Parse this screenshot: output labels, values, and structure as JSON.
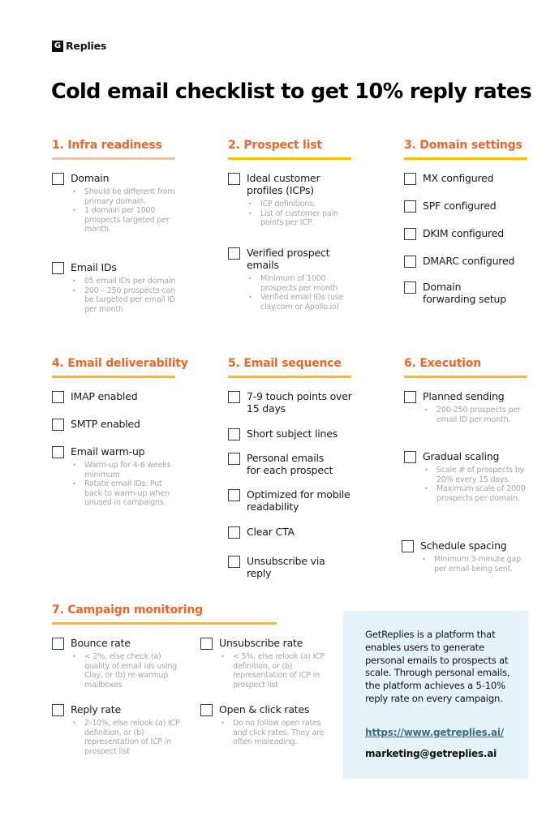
{
  "brand": {
    "logo_mark": "G",
    "name": "Replies"
  },
  "title": "Cold email checklist to get 10% reply rates",
  "colors": {
    "heading": "#e8672a",
    "rule": "#fbbf0f",
    "rule_first": "#f8c2a6",
    "info_bg": "#e5f3fa",
    "link": "#3c6e7f"
  },
  "sections": [
    {
      "heading": "1. Infra readiness",
      "items": [
        {
          "label": "Domain",
          "bullets": [
            "Should be different from primary domain.",
            "1 domain per 1000 prospects targeted per month."
          ]
        },
        {
          "label": "Email IDs",
          "bullets": [
            "05 email IDs per domain",
            "200 – 250 prospects can be targeted per email ID per month"
          ]
        }
      ]
    },
    {
      "heading": "2. Prospect list",
      "items": [
        {
          "label": "Ideal customer profiles (ICPs)",
          "bullets": [
            "ICP definitions.",
            "List of customer pain points per ICP."
          ]
        },
        {
          "label": "Verified prospect emails",
          "bullets": [
            "Minimum of 1000 prospects per month",
            "Verified email IDs (use clay.com or Apollo.io)"
          ]
        }
      ]
    },
    {
      "heading": "3. Domain settings",
      "items": [
        {
          "label": "MX configured",
          "bullets": []
        },
        {
          "label": "SPF configured",
          "bullets": []
        },
        {
          "label": "DKIM configured",
          "bullets": []
        },
        {
          "label": "DMARC configured",
          "bullets": []
        },
        {
          "label": "Domain forwarding setup",
          "bullets": []
        }
      ]
    },
    {
      "heading": "4. Email deliverability",
      "items": [
        {
          "label": "IMAP enabled",
          "bullets": []
        },
        {
          "label": "SMTP enabled",
          "bullets": []
        },
        {
          "label": "Email warm-up",
          "bullets": [
            "Warm-up for 4-6 weeks minimum",
            "Rotate email IDs. Put back to warm-up when unused in campaigns."
          ]
        }
      ]
    },
    {
      "heading": "5. Email sequence",
      "items": [
        {
          "label": "7-9 touch points over 15 days",
          "bullets": []
        },
        {
          "label": "Short subject lines",
          "bullets": []
        },
        {
          "label": "Personal emails for each prospect",
          "bullets": []
        },
        {
          "label": "Optimized for mobile readability",
          "bullets": []
        },
        {
          "label": "Clear CTA",
          "bullets": []
        },
        {
          "label": "Unsubscribe via reply",
          "bullets": []
        }
      ]
    },
    {
      "heading": "6. Execution",
      "items": [
        {
          "label": "Planned sending",
          "bullets": [
            "200-250 prospects per email ID per month."
          ]
        },
        {
          "label": "Gradual scaling",
          "bullets": [
            "Scale # of prospects by 20% every 15 days.",
            "Maximum scale of 2000 prospects per domain."
          ]
        },
        {
          "label": "Schedule spacing",
          "bullets": [
            "Minimum 3-minute gap per email being sent."
          ]
        }
      ]
    },
    {
      "heading": "7. Campaign monitoring",
      "items": [
        {
          "label": "Bounce rate",
          "bullets": [
            "< 2%, else check (a) quality of email ids using Clay, or (b) re-warmup mailboxes"
          ]
        },
        {
          "label": "Unsubscribe rate",
          "bullets": [
            "< 5%, else relook (a) ICP definition, or (b) representation of ICP in prospect list"
          ]
        },
        {
          "label": "Reply rate",
          "bullets": [
            "2-10%, else relook (a) ICP definition, or (b) representation of ICP in prospect list"
          ]
        },
        {
          "label": "Open & click rates",
          "bullets": [
            "Do no follow open rates and click rates. They are often misleading."
          ]
        }
      ]
    }
  ],
  "info": {
    "text": "GetReplies is a platform that enables users to generate personal emails to prospects at scale. Through personal emails, the platform achieves a 5-10% reply rate on every campaign.",
    "link": "https://www.getreplies.ai/",
    "email": "marketing@getreplies.ai"
  }
}
